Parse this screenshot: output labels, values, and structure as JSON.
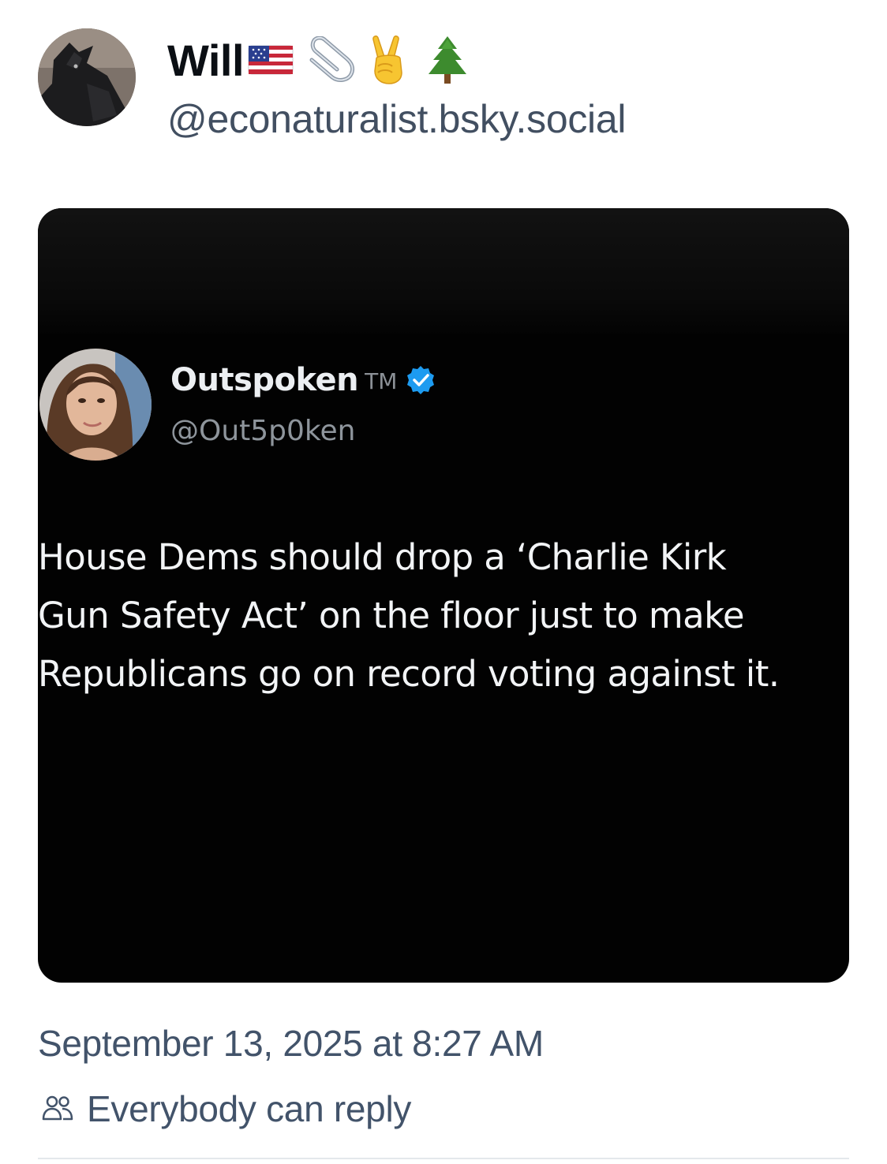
{
  "author": {
    "display_name": "Will",
    "name_emojis": [
      "flag-us-icon",
      "paperclip-icon",
      "victory-hand-icon",
      "evergreen-tree-icon"
    ],
    "handle": "@econaturalist.bsky.social",
    "avatar": "howling-wolf-avatar"
  },
  "embedded_image": {
    "quoted_author": {
      "name": "Outspoken",
      "suffix": "TM",
      "handle": "@Out5p0ken",
      "verified": true,
      "avatar": "woman-portrait-avatar"
    },
    "quoted_text": "House Dems should drop a ‘Charlie Kirk\nGun Safety Act’ on the floor just to make\nRepublicans go on record voting against it."
  },
  "post": {
    "timestamp": "September 13, 2025 at 8:27 AM",
    "reply_setting": "Everybody can reply"
  },
  "colors": {
    "text_primary": "#0b0f14",
    "text_secondary": "#42536a",
    "image_background": "#020202",
    "verified_blue": "#1d9bf0"
  }
}
